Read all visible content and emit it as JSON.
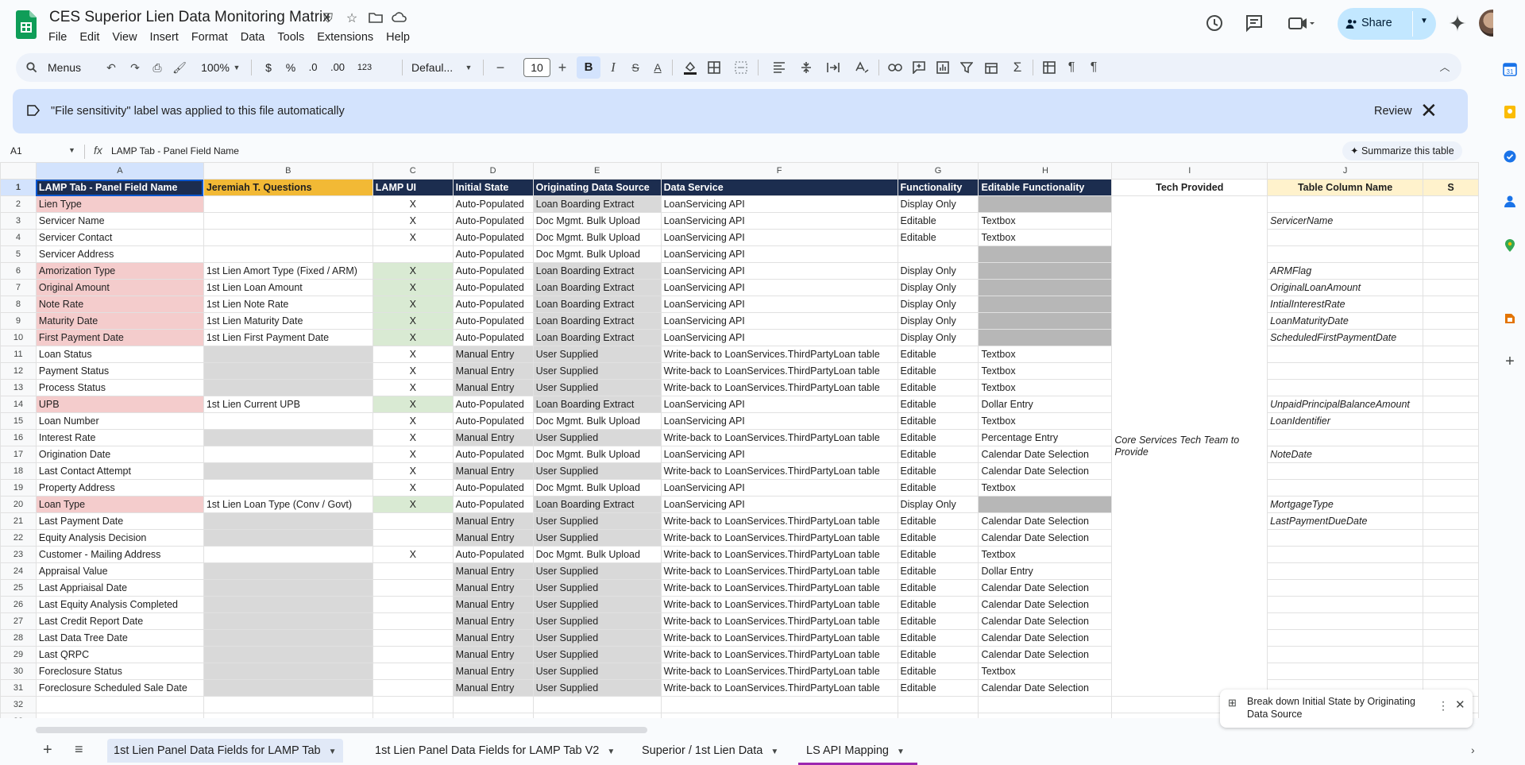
{
  "document": {
    "title": "CES Superior Lien Data Monitoring Matrix",
    "menus": [
      "File",
      "Edit",
      "View",
      "Insert",
      "Format",
      "Data",
      "Tools",
      "Extensions",
      "Help"
    ],
    "share_label": "Share"
  },
  "toolbar": {
    "search_menus": "Menus",
    "zoom": "100%",
    "currency": "$",
    "percent": "%",
    "dec_decrease": ".0",
    "dec_increase": ".00",
    "number_format": "123",
    "font": "Defaul...",
    "font_size": "10"
  },
  "banner": {
    "message": "\"File sensitivity\" label was applied to this file automatically",
    "review": "Review"
  },
  "formula_bar": {
    "cell_ref": "A1",
    "fx": "fx",
    "value": "LAMP Tab - Panel Field Name",
    "summarize": "Summarize this table"
  },
  "columns": [
    "A",
    "B",
    "C",
    "D",
    "E",
    "F",
    "G",
    "H",
    "I",
    "J",
    ""
  ],
  "header_row": {
    "A": "LAMP Tab - Panel Field Name",
    "B": "Jeremiah T. Questions",
    "C": "LAMP UI",
    "D": "Initial State",
    "E": "Originating Data Source",
    "F": "Data Service",
    "G": "Functionality",
    "H": "Editable Functionality",
    "I": "Tech Provided",
    "J": "Table Column Name",
    "K": "S"
  },
  "tech_provided_merged": "Core Services Tech Team to Provide",
  "rows": [
    {
      "n": "2",
      "a": "Lien Type",
      "b": "",
      "c": "X",
      "d": "Auto-Populated",
      "e": "Loan Boarding Extract",
      "f": "LoanServicing API",
      "g": "Display Only",
      "h": "",
      "j": ""
    },
    {
      "n": "3",
      "a": "Servicer Name",
      "b": "",
      "c": "X",
      "d": "Auto-Populated",
      "e": "Doc Mgmt. Bulk Upload",
      "f": "LoanServicing API",
      "g": "Editable",
      "h": "Textbox",
      "j": "ServicerName"
    },
    {
      "n": "4",
      "a": "Servicer Contact",
      "b": "",
      "c": "X",
      "d": "Auto-Populated",
      "e": "Doc Mgmt. Bulk Upload",
      "f": "LoanServicing API",
      "g": "Editable",
      "h": "Textbox",
      "j": ""
    },
    {
      "n": "5",
      "a": "Servicer Address",
      "b": "",
      "c": "",
      "d": "Auto-Populated",
      "e": "Doc Mgmt. Bulk Upload",
      "f": "LoanServicing API",
      "g": "",
      "h": "",
      "j": ""
    },
    {
      "n": "6",
      "a": "Amorization Type",
      "b": "1st Lien Amort Type (Fixed / ARM)",
      "c": "X",
      "d": "Auto-Populated",
      "e": "Loan Boarding Extract",
      "f": "LoanServicing API",
      "g": "Display Only",
      "h": "",
      "j": "ARMFlag"
    },
    {
      "n": "7",
      "a": "Original Amount",
      "b": "1st Lien Loan Amount",
      "c": "X",
      "d": "Auto-Populated",
      "e": "Loan Boarding Extract",
      "f": "LoanServicing API",
      "g": "Display Only",
      "h": "",
      "j": "OriginalLoanAmount"
    },
    {
      "n": "8",
      "a": "Note Rate",
      "b": "1st Lien Note Rate",
      "c": "X",
      "d": "Auto-Populated",
      "e": "Loan Boarding Extract",
      "f": "LoanServicing API",
      "g": "Display Only",
      "h": "",
      "j": "IntialInterestRate"
    },
    {
      "n": "9",
      "a": "Maturity Date",
      "b": "1st Lien Maturity Date",
      "c": "X",
      "d": "Auto-Populated",
      "e": "Loan Boarding Extract",
      "f": "LoanServicing API",
      "g": "Display Only",
      "h": "",
      "j": "LoanMaturityDate"
    },
    {
      "n": "10",
      "a": "First Payment Date",
      "b": "1st Lien First Payment Date",
      "c": "X",
      "d": "Auto-Populated",
      "e": "Loan Boarding Extract",
      "f": "LoanServicing API",
      "g": "Display Only",
      "h": "",
      "j": "ScheduledFirstPaymentDate"
    },
    {
      "n": "11",
      "a": "Loan Status",
      "b": "",
      "c": "X",
      "d": "Manual Entry",
      "e": "User Supplied",
      "f": "Write-back to LoanServices.ThirdPartyLoan table",
      "g": "Editable",
      "h": "Textbox",
      "j": ""
    },
    {
      "n": "12",
      "a": "Payment Status",
      "b": "",
      "c": "X",
      "d": "Manual Entry",
      "e": "User Supplied",
      "f": "Write-back to LoanServices.ThirdPartyLoan table",
      "g": "Editable",
      "h": "Textbox",
      "j": ""
    },
    {
      "n": "13",
      "a": "Process Status",
      "b": "",
      "c": "X",
      "d": "Manual Entry",
      "e": "User Supplied",
      "f": "Write-back to LoanServices.ThirdPartyLoan table",
      "g": "Editable",
      "h": "Textbox",
      "j": ""
    },
    {
      "n": "14",
      "a": "UPB",
      "b": "1st Lien Current UPB",
      "c": "X",
      "d": "Auto-Populated",
      "e": "Loan Boarding Extract",
      "f": "LoanServicing API",
      "g": "Editable",
      "h": "Dollar Entry",
      "j": "UnpaidPrincipalBalanceAmount"
    },
    {
      "n": "15",
      "a": "Loan Number",
      "b": "",
      "c": "X",
      "d": "Auto-Populated",
      "e": "Doc Mgmt. Bulk Upload",
      "f": "LoanServicing API",
      "g": "Editable",
      "h": "Textbox",
      "j": "LoanIdentifier"
    },
    {
      "n": "16",
      "a": "Interest Rate",
      "b": "",
      "c": "X",
      "d": "Manual Entry",
      "e": "User Supplied",
      "f": "Write-back to LoanServices.ThirdPartyLoan table",
      "g": "Editable",
      "h": "Percentage Entry",
      "j": ""
    },
    {
      "n": "17",
      "a": "Origination Date",
      "b": "",
      "c": "X",
      "d": "Auto-Populated",
      "e": "Doc Mgmt. Bulk Upload",
      "f": "LoanServicing API",
      "g": "Editable",
      "h": "Calendar Date Selection",
      "j": "NoteDate"
    },
    {
      "n": "18",
      "a": "Last Contact Attempt",
      "b": "",
      "c": "X",
      "d": "Manual Entry",
      "e": "User Supplied",
      "f": "Write-back to LoanServices.ThirdPartyLoan table",
      "g": "Editable",
      "h": "Calendar Date Selection",
      "j": ""
    },
    {
      "n": "19",
      "a": "Property Address",
      "b": "",
      "c": "X",
      "d": "Auto-Populated",
      "e": "Doc Mgmt. Bulk Upload",
      "f": "LoanServicing API",
      "g": "Editable",
      "h": "Textbox",
      "j": ""
    },
    {
      "n": "20",
      "a": "Loan Type",
      "b": "1st Lien Loan Type (Conv / Govt)",
      "c": "X",
      "d": "Auto-Populated",
      "e": "Loan Boarding Extract",
      "f": "LoanServicing API",
      "g": "Display Only",
      "h": "",
      "j": "MortgageType"
    },
    {
      "n": "21",
      "a": "Last Payment Date",
      "b": "",
      "c": "",
      "d": "Manual Entry",
      "e": "User Supplied",
      "f": "Write-back to LoanServices.ThirdPartyLoan table",
      "g": "Editable",
      "h": "Calendar Date Selection",
      "j": "LastPaymentDueDate"
    },
    {
      "n": "22",
      "a": "Equity Analysis Decision",
      "b": "",
      "c": "",
      "d": "Manual Entry",
      "e": "User Supplied",
      "f": "Write-back to LoanServices.ThirdPartyLoan table",
      "g": "Editable",
      "h": "Calendar Date Selection",
      "j": ""
    },
    {
      "n": "23",
      "a": "Customer - Mailing Address",
      "b": "",
      "c": "X",
      "d": "Auto-Populated",
      "e": "Doc Mgmt. Bulk Upload",
      "f": "Write-back to LoanServices.ThirdPartyLoan table",
      "g": "Editable",
      "h": "Textbox",
      "j": ""
    },
    {
      "n": "24",
      "a": "Appraisal Value",
      "b": "",
      "c": "",
      "d": "Manual Entry",
      "e": "User Supplied",
      "f": "Write-back to LoanServices.ThirdPartyLoan table",
      "g": "Editable",
      "h": "Dollar Entry",
      "j": ""
    },
    {
      "n": "25",
      "a": "Last Appriaisal Date",
      "b": "",
      "c": "",
      "d": "Manual Entry",
      "e": "User Supplied",
      "f": "Write-back to LoanServices.ThirdPartyLoan table",
      "g": "Editable",
      "h": "Calendar Date Selection",
      "j": ""
    },
    {
      "n": "26",
      "a": "Last Equity Analysis Completed",
      "b": "",
      "c": "",
      "d": "Manual Entry",
      "e": "User Supplied",
      "f": "Write-back to LoanServices.ThirdPartyLoan table",
      "g": "Editable",
      "h": "Calendar Date Selection",
      "j": ""
    },
    {
      "n": "27",
      "a": "Last Credit Report Date",
      "b": "",
      "c": "",
      "d": "Manual Entry",
      "e": "User Supplied",
      "f": "Write-back to LoanServices.ThirdPartyLoan table",
      "g": "Editable",
      "h": "Calendar Date Selection",
      "j": ""
    },
    {
      "n": "28",
      "a": "Last Data Tree Date",
      "b": "",
      "c": "",
      "d": "Manual Entry",
      "e": "User Supplied",
      "f": "Write-back to LoanServices.ThirdPartyLoan table",
      "g": "Editable",
      "h": "Calendar Date Selection",
      "j": ""
    },
    {
      "n": "29",
      "a": "Last QRPC",
      "b": "",
      "c": "",
      "d": "Manual Entry",
      "e": "User Supplied",
      "f": "Write-back to LoanServices.ThirdPartyLoan table",
      "g": "Editable",
      "h": "Calendar Date Selection",
      "j": ""
    },
    {
      "n": "30",
      "a": "Foreclosure Status",
      "b": "",
      "c": "",
      "d": "Manual Entry",
      "e": "User Supplied",
      "f": "Write-back to LoanServices.ThirdPartyLoan table",
      "g": "Editable",
      "h": "Textbox",
      "j": ""
    },
    {
      "n": "31",
      "a": "Foreclosure Scheduled Sale Date",
      "b": "",
      "c": "",
      "d": "Manual Entry",
      "e": "User Supplied",
      "f": "Write-back to LoanServices.ThirdPartyLoan table",
      "g": "Editable",
      "h": "Calendar Date Selection",
      "j": ""
    },
    {
      "n": "32",
      "a": "",
      "b": "",
      "c": "",
      "d": "",
      "e": "",
      "f": "",
      "g": "",
      "h": "",
      "j": ""
    },
    {
      "n": "33",
      "a": "",
      "b": "",
      "c": "",
      "d": "",
      "e": "",
      "f": "",
      "g": "",
      "h": "",
      "j": ""
    }
  ],
  "sheet_tabs": [
    {
      "label": "1st Lien Panel Data Fields for LAMP Tab",
      "active": true
    },
    {
      "label": "1st Lien Panel Data Fields for LAMP Tab V2",
      "active": false
    },
    {
      "label": "Superior / 1st Lien Data",
      "active": false
    },
    {
      "label": "LS API Mapping",
      "active": false
    }
  ],
  "toast": {
    "text": "Break down Initial State by Originating Data Source"
  },
  "colors": {
    "header_dark": "#1c2d4f",
    "header_gold": "#f2b935",
    "pink": "#f4cccc",
    "light_green": "#d9ead3",
    "gray": "#d9d9d9",
    "dark_gray": "#b7b7b7",
    "share_blue": "#c2e7ff",
    "banner_blue": "#d3e3fd"
  }
}
